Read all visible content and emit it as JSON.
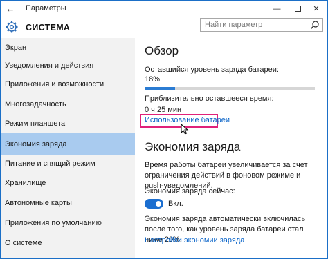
{
  "window": {
    "title": "Параметры"
  },
  "titlebar": {
    "back_icon": "arrow-left-icon",
    "minimize": "—",
    "close": "✕"
  },
  "header": {
    "title": "СИСТЕМА",
    "icon": "gear-icon"
  },
  "search": {
    "placeholder": "Найти параметр",
    "icon": "search-icon"
  },
  "sidebar": {
    "items": [
      {
        "label": "Экран"
      },
      {
        "label": "Уведомления и действия"
      },
      {
        "label": "Приложения и возможности"
      },
      {
        "label": "Многозадачность"
      },
      {
        "label": "Режим планшета"
      },
      {
        "label": "Экономия заряда"
      },
      {
        "label": "Питание и спящий режим"
      },
      {
        "label": "Хранилище"
      },
      {
        "label": "Автономные карты"
      },
      {
        "label": "Приложения по умолчанию"
      },
      {
        "label": "О системе"
      }
    ],
    "active_index": 5
  },
  "overview": {
    "title": "Обзор",
    "remaining_label": "Оставшийся уровень заряда батареи:",
    "remaining_value": "18%",
    "remaining_fraction": 0.18,
    "time_label": "Приблизительно оставшееся время:",
    "time_value": "0 ч 25 мин",
    "usage_link": "Использование батареи"
  },
  "battery_saver": {
    "title": "Экономия заряда",
    "description": "Время работы батареи увеличивается за счет ограничения действий в фоновом режиме и push-уведомлений.",
    "now_label": "Экономия заряда сейчас:",
    "toggle_state": "Вкл.",
    "toggle_on": true,
    "auto_text": "Экономия заряда автоматически включилась после того, как уровень заряда батареи стал ниже 20%.",
    "settings_link": "Настройки экономии заряда"
  },
  "colors": {
    "accent": "#1a6ed0",
    "active_nav": "#a9cbef",
    "highlight_box": "#e0217a",
    "link": "#0a64c8"
  }
}
